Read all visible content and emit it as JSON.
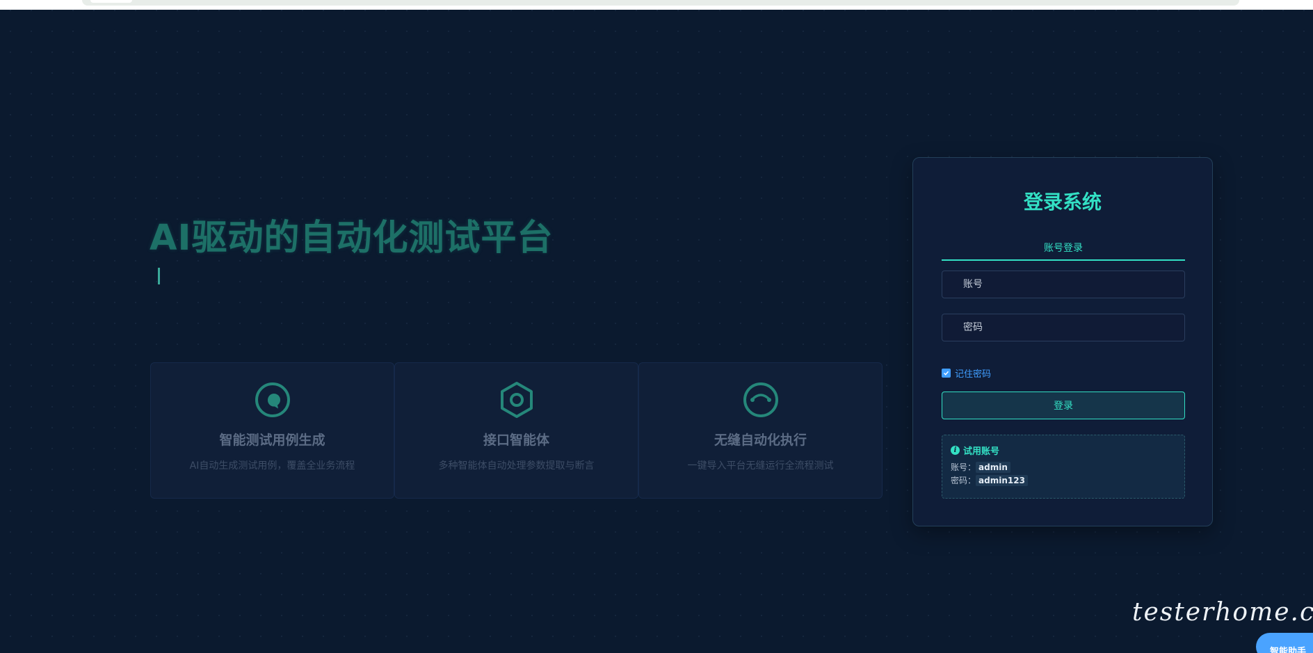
{
  "hero": {
    "title": "AI驱动的自动化测试平台"
  },
  "features": [
    {
      "icon": "chat-bubble-icon",
      "title": "智能测试用例生成",
      "desc": "AI自动生成测试用例，覆盖全业务流程"
    },
    {
      "icon": "hexagon-nut-icon",
      "title": "接口智能体",
      "desc": "多种智能体自动处理参数提取与断言"
    },
    {
      "icon": "automation-cycle-icon",
      "title": "无缝自动化执行",
      "desc": "一键导入平台无缝运行全流程测试"
    }
  ],
  "login": {
    "title": "登录系统",
    "tab_label": "账号登录",
    "account_placeholder": "账号",
    "password_placeholder": "密码",
    "remember_label": "记住密码",
    "remember_checked": true,
    "submit_label": "登录",
    "trial": {
      "title": "试用账号",
      "account_label": "账号：",
      "account_value": "admin",
      "password_label": "密码：",
      "password_value": "admin123"
    }
  },
  "watermark": "testerhome.com",
  "assistant_label": "智能助手",
  "colors": {
    "accent": "#33e0c4",
    "background": "#0b1a2f",
    "checkbox": "#409eff"
  }
}
